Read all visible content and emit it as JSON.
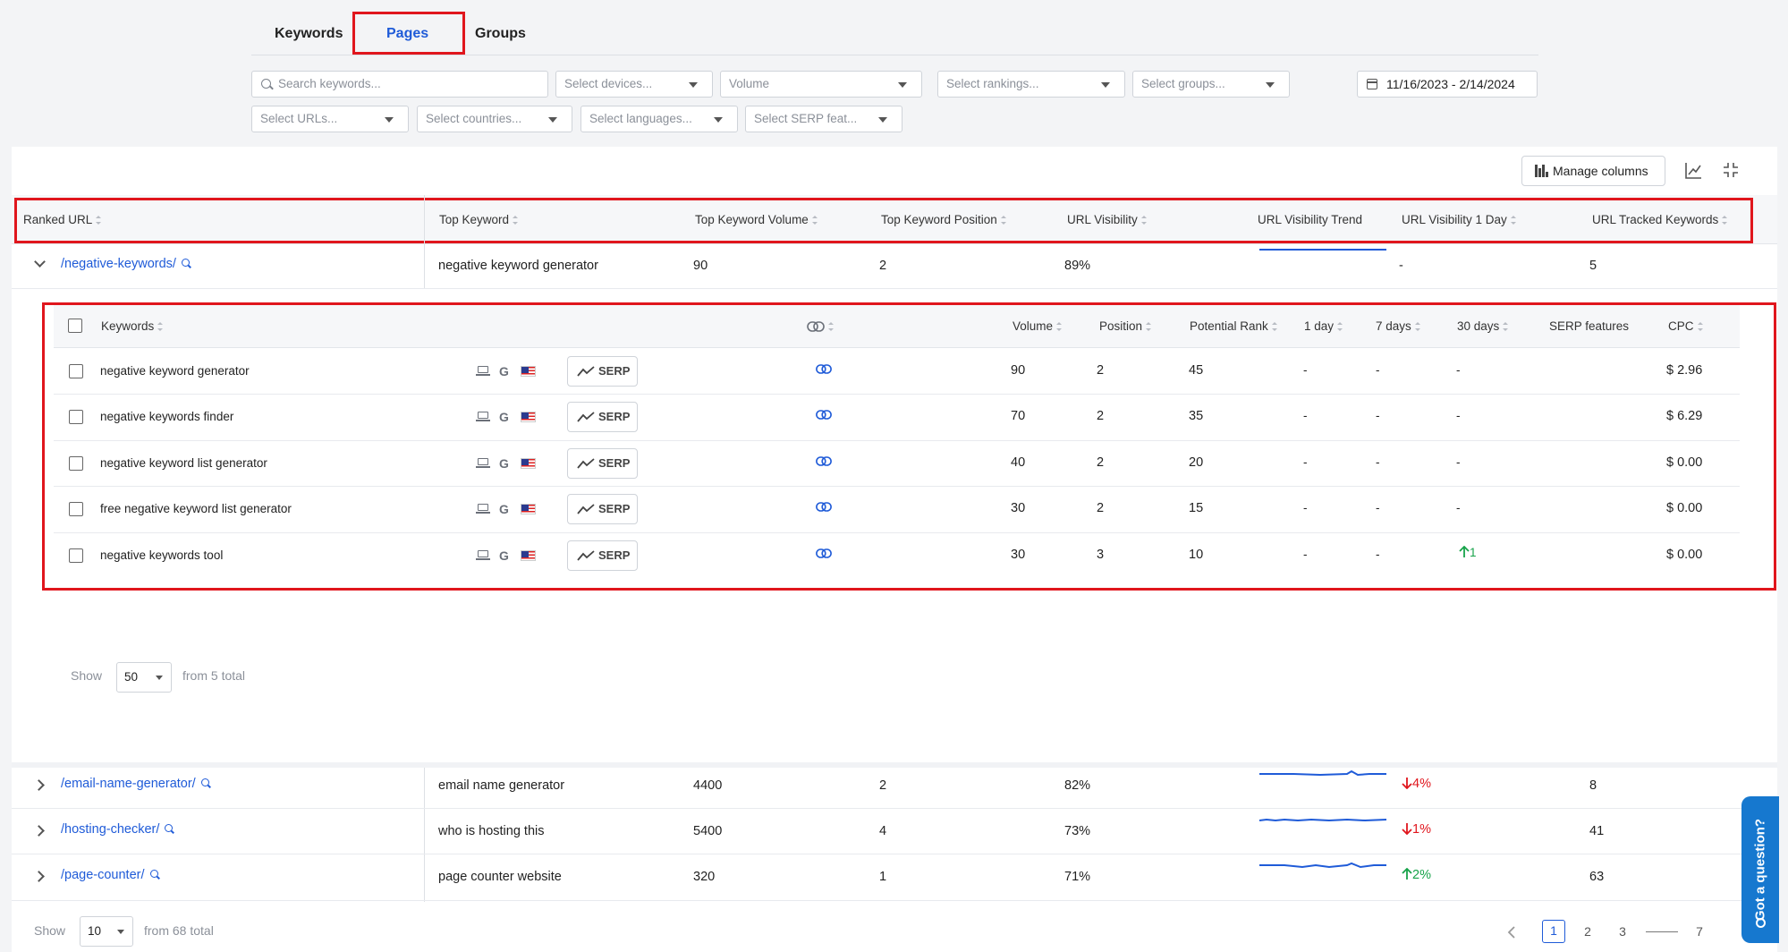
{
  "tabs": [
    {
      "label": "Keywords"
    },
    {
      "label": "Pages"
    },
    {
      "label": "Groups"
    }
  ],
  "filters": {
    "search_placeholder": "Search keywords...",
    "devices": "Select devices...",
    "volume": "Volume",
    "rankings": "Select rankings...",
    "groups": "Select groups...",
    "date_range": "11/16/2023 - 2/14/2024",
    "urls": "Select URLs...",
    "countries": "Select countries...",
    "languages": "Select languages...",
    "serp_features": "Select SERP feat..."
  },
  "toolbar": {
    "manage_columns": "Manage columns"
  },
  "columns": {
    "ranked_url": "Ranked URL",
    "top_keyword": "Top Keyword",
    "top_keyword_volume": "Top Keyword Volume",
    "top_keyword_position": "Top Keyword Position",
    "url_visibility": "URL Visibility",
    "url_visibility_trend": "URL Visibility Trend",
    "url_visibility_1day": "URL Visibility 1 Day",
    "url_tracked_keywords": "URL Tracked Keywords"
  },
  "expanded_row": {
    "url": "/negative-keywords/",
    "top_keyword": "negative keyword generator",
    "volume": "90",
    "position": "2",
    "visibility": "89%",
    "day_change": "-",
    "tracked": "5"
  },
  "sub_columns": {
    "keywords": "Keywords",
    "volume": "Volume",
    "position": "Position",
    "potential_rank": "Potential Rank",
    "d1": "1 day",
    "d7": "7 days",
    "d30": "30 days",
    "serp_features": "SERP features",
    "cpc": "CPC"
  },
  "serp_label": "SERP",
  "sub_rows": [
    {
      "keyword": "negative keyword generator",
      "volume": "90",
      "position": "2",
      "potential": "45",
      "d1": "-",
      "d7": "-",
      "d30": "-",
      "cpc": "$ 2.96"
    },
    {
      "keyword": "negative keywords finder",
      "volume": "70",
      "position": "2",
      "potential": "35",
      "d1": "-",
      "d7": "-",
      "d30": "-",
      "cpc": "$ 6.29"
    },
    {
      "keyword": "negative keyword list generator",
      "volume": "40",
      "position": "2",
      "potential": "20",
      "d1": "-",
      "d7": "-",
      "d30": "-",
      "cpc": "$ 0.00"
    },
    {
      "keyword": "free negative keyword list generator",
      "volume": "30",
      "position": "2",
      "potential": "15",
      "d1": "-",
      "d7": "-",
      "d30": "-",
      "cpc": "$ 0.00"
    },
    {
      "keyword": "negative keywords tool",
      "volume": "30",
      "position": "3",
      "potential": "10",
      "d1": "-",
      "d7": "-",
      "d30": "1",
      "cpc": "$ 0.00"
    }
  ],
  "inner_pager": {
    "show_label": "Show",
    "page_size": "50",
    "total_text": "from 5 total"
  },
  "rows": [
    {
      "url": "/email-name-generator/",
      "top_keyword": "email name generator",
      "volume": "4400",
      "position": "2",
      "visibility": "82%",
      "day_change": "4%",
      "tracked": "8"
    },
    {
      "url": "/hosting-checker/",
      "top_keyword": "who is hosting this",
      "volume": "5400",
      "position": "4",
      "visibility": "73%",
      "day_change": "1%",
      "tracked": "41"
    },
    {
      "url": "/page-counter/",
      "top_keyword": "page counter website",
      "volume": "320",
      "position": "1",
      "visibility": "71%",
      "day_change": "2%",
      "tracked": "63"
    }
  ],
  "pager": {
    "show_label": "Show",
    "page_size": "10",
    "total_text": "from 68 total",
    "pages": [
      "1",
      "2",
      "3",
      "7"
    ]
  },
  "help": {
    "label": "Got a question?"
  },
  "colors": {
    "accent": "#1f5bd8",
    "up": "#17a34a",
    "down": "#e0161d",
    "highlight": "#e0161d"
  }
}
